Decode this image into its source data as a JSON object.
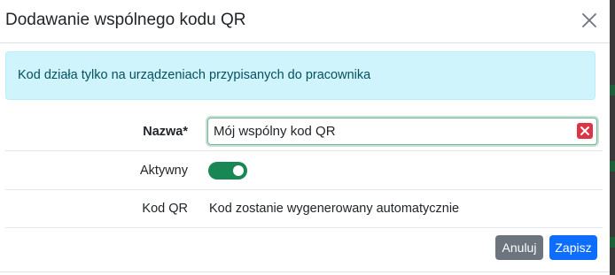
{
  "dialog": {
    "title": "Dodawanie wspólnego kodu QR",
    "close_icon": "close-icon"
  },
  "alert": {
    "text": "Kod działa tylko na urządzeniach przypisanych do pracownika",
    "color": "#cff4fc"
  },
  "form": {
    "name": {
      "label": "Nazwa*",
      "value": "Mój wspólny kod QR",
      "clear_icon": "clear-icon"
    },
    "active": {
      "label": "Aktywny",
      "checked": true,
      "color": "#198754"
    },
    "qr_code": {
      "label": "Kod QR",
      "value": "Kod zostanie wygenerowany automatycznie"
    }
  },
  "footer": {
    "cancel_label": "Anuluj",
    "save_label": "Zapisz",
    "save_color": "#0d6efd",
    "cancel_color": "#6c757d"
  }
}
